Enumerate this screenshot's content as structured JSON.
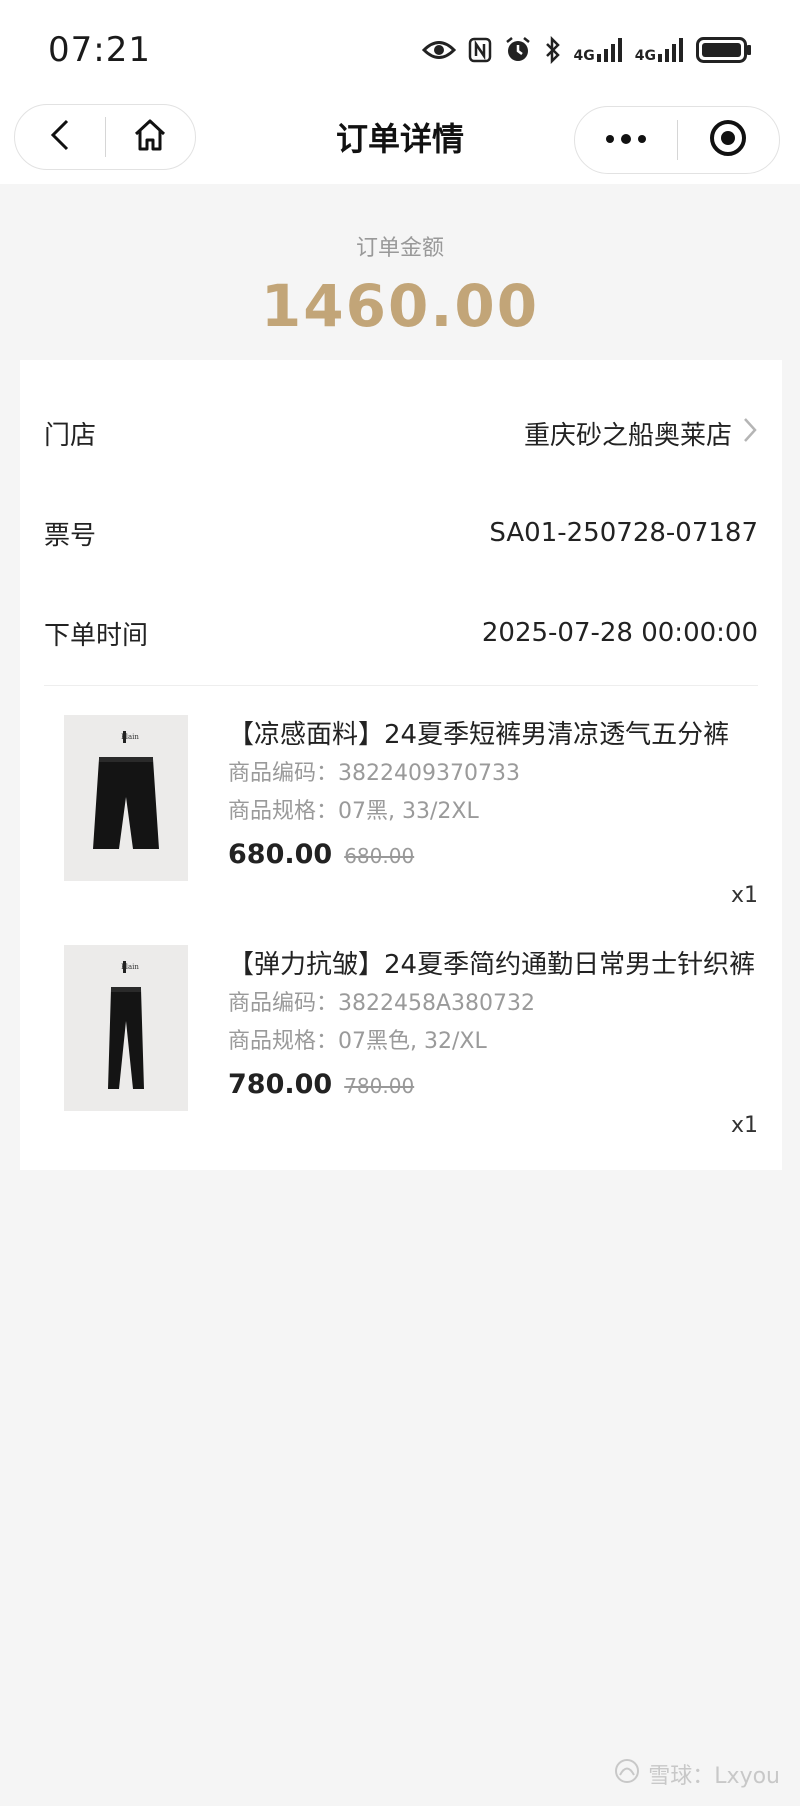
{
  "status_bar": {
    "time": "07:21",
    "icons": [
      "eye-icon",
      "nfc-icon",
      "alarm-icon",
      "bluetooth-icon",
      "signal-4g-icon",
      "signal-4g-icon",
      "battery-icon"
    ],
    "network_label_1": "4G",
    "network_label_2": "4G"
  },
  "nav": {
    "title": "订单详情",
    "back_icon": "chevron-left-icon",
    "home_icon": "home-icon",
    "more_icon": "more-dots-icon",
    "close_icon": "target-icon"
  },
  "order": {
    "amount_label": "订单金额",
    "amount": "1460.00",
    "store_label": "门店",
    "store_value": "重庆砂之船奥莱店",
    "ticket_label": "票号",
    "ticket_value": "SA01-250728-07187",
    "time_label": "下单时间",
    "time_value": "2025-07-28 00:00:00"
  },
  "products": [
    {
      "title": "【凉感面料】24夏季短裤男清凉透气五分裤",
      "code_label": "商品编码：",
      "code": "3822409370733",
      "spec_label": "商品规格：",
      "spec": "07黑, 33/2XL",
      "price": "680.00",
      "original_price": "680.00",
      "qty": "x1",
      "image_icon": "shorts-icon"
    },
    {
      "title": "【弹力抗皱】24夏季简约通勤日常男士针织裤",
      "code_label": "商品编码：",
      "code": "3822458A380732",
      "spec_label": "商品规格：",
      "spec": "07黑色, 32/XL",
      "price": "780.00",
      "original_price": "780.00",
      "qty": "x1",
      "image_icon": "trousers-icon"
    }
  ],
  "watermark": {
    "text": "雪球：Lxyou"
  },
  "colors": {
    "accent_gold": "#c2a578",
    "background": "#f5f5f5",
    "card": "#ffffff"
  }
}
